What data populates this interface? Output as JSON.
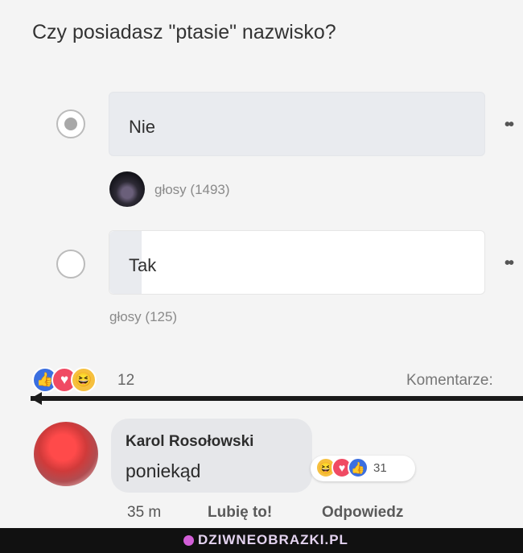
{
  "poll": {
    "question": "Czy posiadasz \"ptasie\" nazwisko?",
    "options": [
      {
        "label": "Nie",
        "votes_text": "głosy (1493)",
        "selected": true
      },
      {
        "label": "Tak",
        "votes_text": "głosy (125)",
        "selected": false
      }
    ],
    "more_glyph": "••"
  },
  "reactions": {
    "icons": [
      "like-icon",
      "love-icon",
      "haha-icon"
    ],
    "count": "12",
    "comments_link": "Komentarze:"
  },
  "comment": {
    "author": "Karol Rosołowski",
    "text": "poniekąd",
    "reaction_icons": [
      "haha-icon",
      "love-icon",
      "like-icon"
    ],
    "reaction_count": "31",
    "time": "35 m",
    "like_label": "Lubię to!",
    "reply_label": "Odpowiedz"
  },
  "watermark": {
    "text": "DZIWNEOBRAZKI.PL"
  },
  "colors": {
    "like": "#3b6fe0",
    "love": "#f04a63",
    "haha": "#f6c03e",
    "bubble": "#e6e7ea",
    "option_bg": "#e9ebef"
  }
}
